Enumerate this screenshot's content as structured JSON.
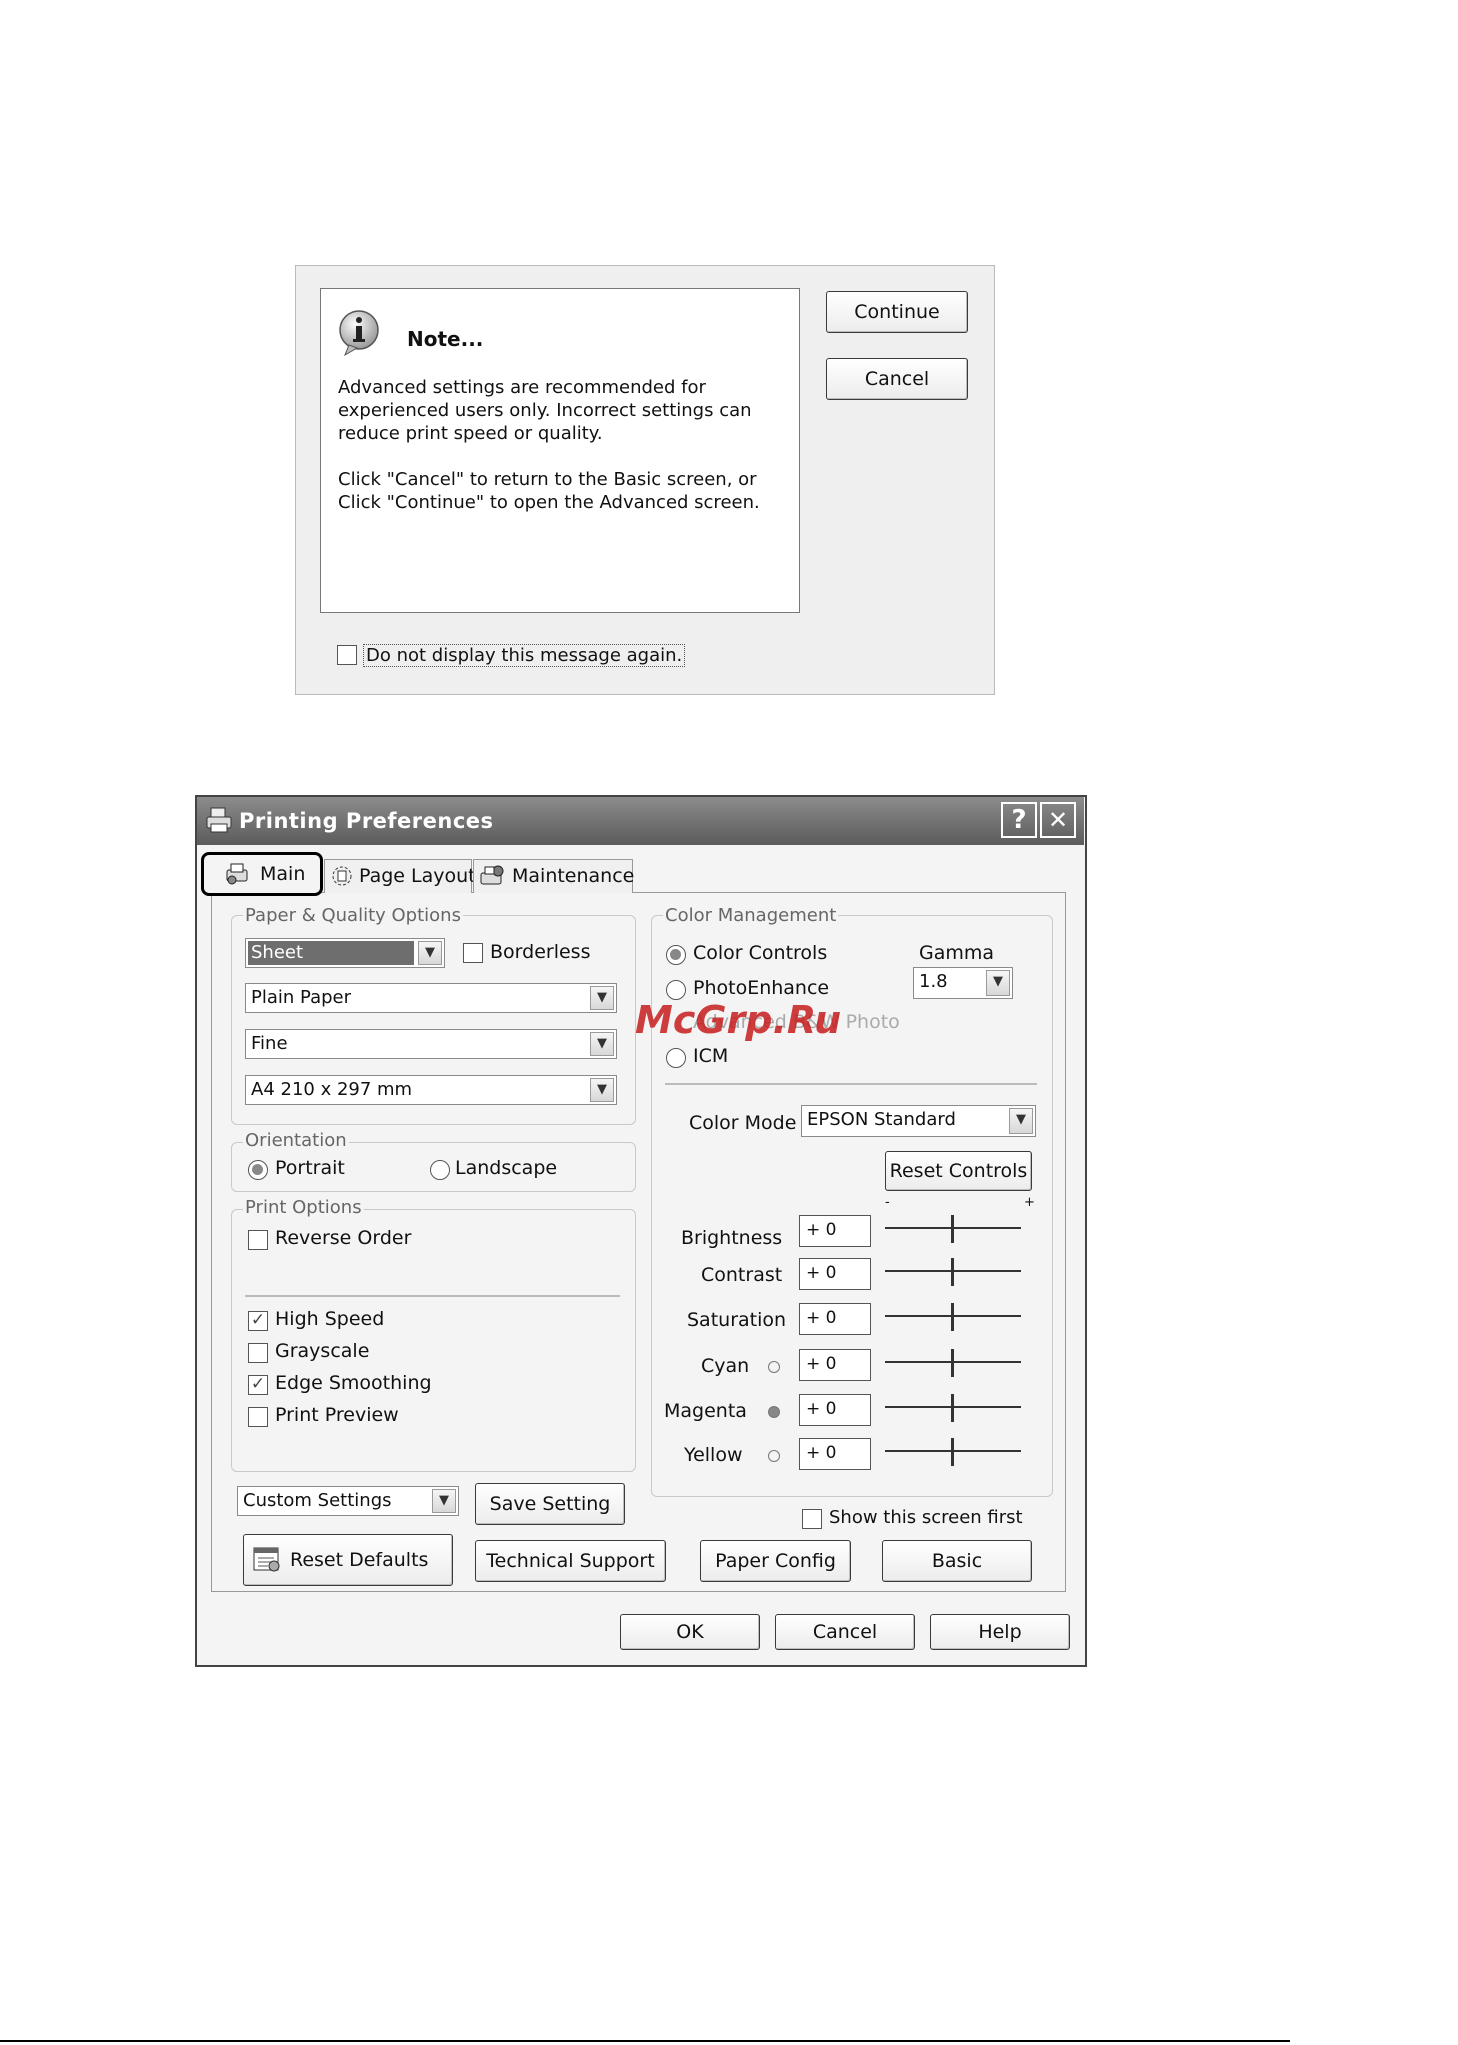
{
  "watermark": "McGrp.Ru",
  "note_dialog": {
    "title": "Note...",
    "body_line1": "Advanced settings are recommended for",
    "body_line2": "experienced users only. Incorrect settings can",
    "body_line3": "reduce print speed or quality.",
    "body_line4": "Click \"Cancel\" to return to the Basic screen, or",
    "body_line5": "Click \"Continue\" to open the Advanced screen.",
    "continue_label": "Continue",
    "cancel_label": "Cancel",
    "dont_show_label": "Do not display this message again."
  },
  "prefs": {
    "title": "Printing Preferences",
    "help_glyph": "?",
    "close_glyph": "✕",
    "tabs": [
      {
        "label": "Main",
        "active": true
      },
      {
        "label": "Page Layout"
      },
      {
        "label": "Maintenance"
      }
    ],
    "paper_quality": {
      "title": "Paper & Quality Options",
      "source": "Sheet",
      "borderless_label": "Borderless",
      "media": "Plain Paper",
      "quality": "Fine",
      "size": "A4 210 x 297 mm"
    },
    "orientation": {
      "title": "Orientation",
      "portrait": "Portrait",
      "landscape": "Landscape",
      "selected": "Portrait"
    },
    "print_options": {
      "title": "Print Options",
      "reverse_order": "Reverse Order",
      "high_speed": "High Speed",
      "grayscale": "Grayscale",
      "edge_smoothing": "Edge Smoothing",
      "print_preview": "Print Preview"
    },
    "custom_settings": "Custom Settings",
    "save_setting": "Save Setting",
    "reset_defaults": "Reset Defaults",
    "technical_support": "Technical Support",
    "color_management": {
      "title": "Color Management",
      "color_controls": "Color Controls",
      "photo_enhance": "PhotoEnhance",
      "advanced_bw_photo": "Advanced B&W Photo",
      "icm": "ICM",
      "gamma_label": "Gamma",
      "gamma_value": "1.8",
      "color_mode_label": "Color Mode",
      "color_mode_value": "EPSON Standard",
      "reset_controls": "Reset Controls",
      "minus": "-",
      "plus": "+",
      "sliders": [
        {
          "label": "Brightness",
          "value": "+ 0"
        },
        {
          "label": "Contrast",
          "value": "+ 0"
        },
        {
          "label": "Saturation",
          "value": "+ 0"
        },
        {
          "label": "Cyan",
          "value": "+ 0"
        },
        {
          "label": "Magenta",
          "value": "+ 0"
        },
        {
          "label": "Yellow",
          "value": "+ 0"
        }
      ]
    },
    "show_this_screen_first": "Show this screen first",
    "paper_config": "Paper Config",
    "basic": "Basic",
    "ok": "OK",
    "cancel": "Cancel",
    "help": "Help"
  }
}
